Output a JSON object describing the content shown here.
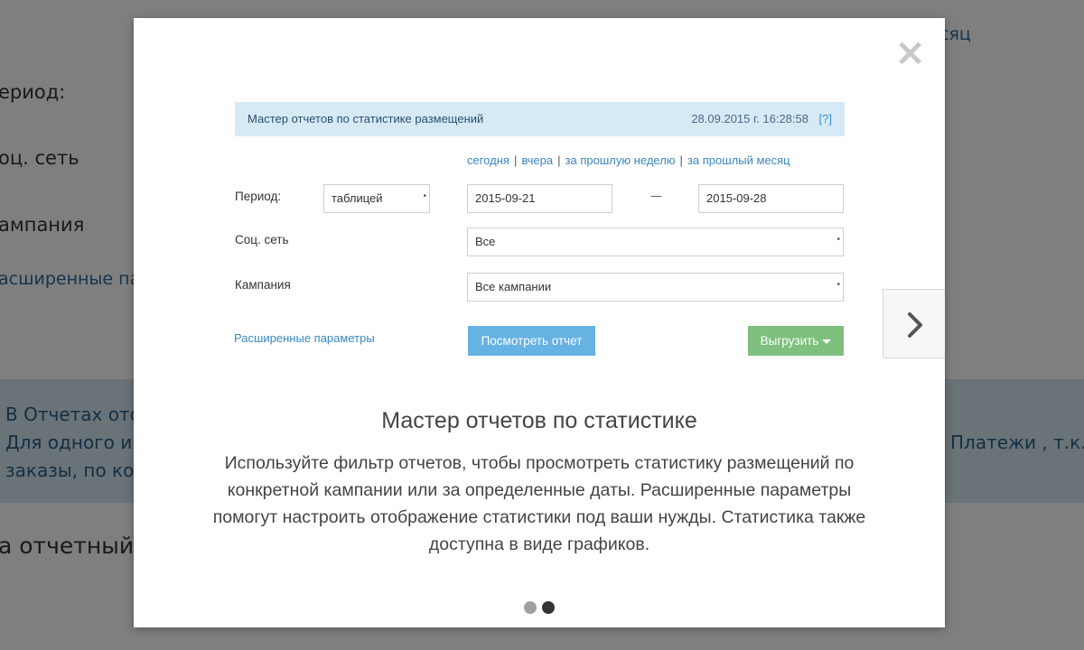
{
  "background": {
    "line1": "ериод:",
    "line2": "оц. сеть",
    "line3": "ампания",
    "line4": "асширенные па",
    "top_right": "сяц",
    "band_line1": "В Отчетах ото",
    "band_line2": "Для одного и",
    "band_line3": "заказы, по кот",
    "band_right": "Платежи , т.к. в",
    "bottom": "а отчетный"
  },
  "modal": {
    "close_label": "×",
    "form": {
      "header_title": "Мастер отчетов по статистике размещений",
      "header_datetime": "28.09.2015 г. 16:28:58",
      "header_help": "[?]",
      "quick_links": [
        "сегодня",
        "вчера",
        "за прошлую неделю",
        "за прошлый месяц"
      ],
      "period_label": "Период:",
      "period_view": "таблицей",
      "date_from": "2015-09-21",
      "date_dash": "—",
      "date_to": "2015-09-28",
      "social_label": "Соц. сеть",
      "social_value": "Все",
      "campaign_label": "Кампания",
      "campaign_value": "Все кампании",
      "advanced_link": "Расширенные параметры",
      "view_button": "Посмотреть отчет",
      "export_button": "Выгрузить"
    },
    "title": "Мастер отчетов по статистике",
    "description": "Используйте фильтр отчетов, чтобы просмотреть статистику размещений по конкретной кампании или за определенные даты. Расширенные параметры помогут настроить отображение статистики под ваши нужды. Статистика также доступна в виде графиков.",
    "pagination": {
      "total": 2,
      "current": 2
    }
  },
  "icons": {
    "close": "close-icon",
    "next": "chevron-right-icon"
  },
  "colors": {
    "header_bg": "#d6eaf5",
    "view_button": "#66b2e3",
    "export_button": "#7ec07d",
    "link": "#3a87bf"
  }
}
